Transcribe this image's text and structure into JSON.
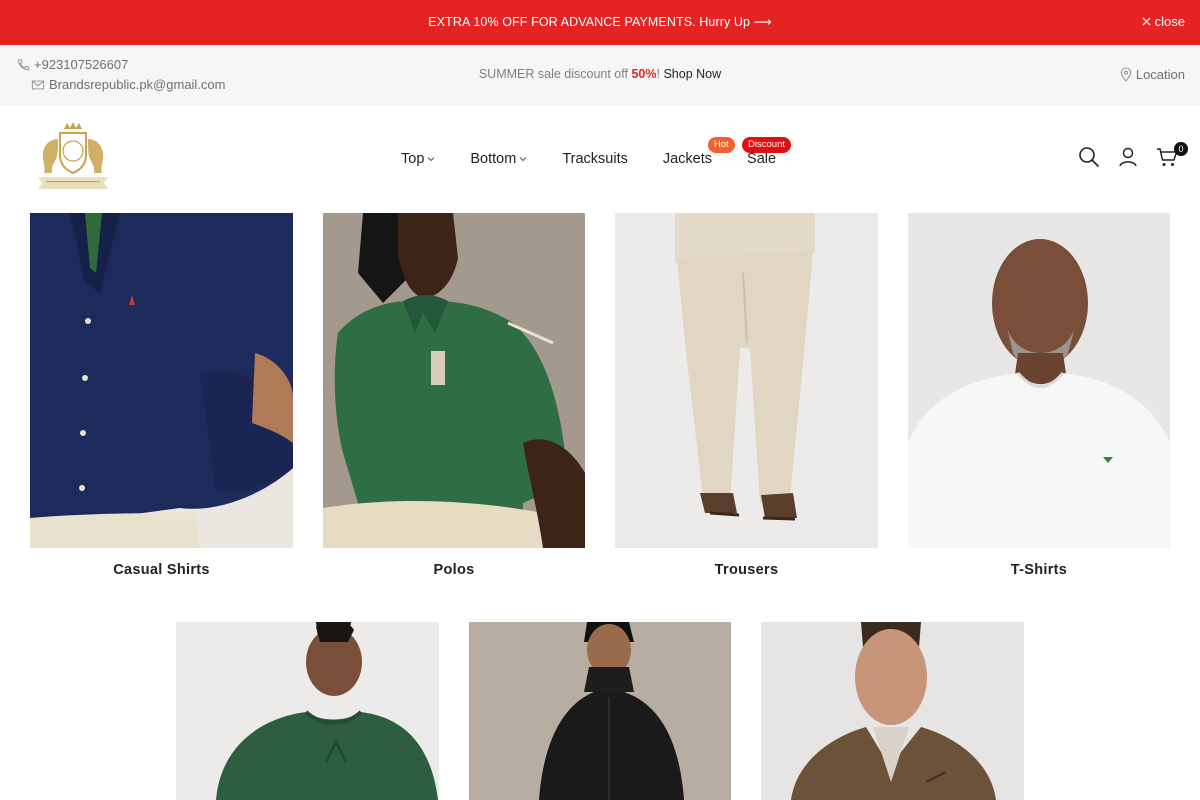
{
  "promo": {
    "text": "EXTRA 10% OFF FOR ADVANCE PAYMENTS. Hurry Up ⟶",
    "close_label": "close"
  },
  "infobar": {
    "phone": "+923107526607",
    "email": "Brandsrepublic.pk@gmail.com",
    "summer_prefix": "SUMMER sale discount off ",
    "summer_pct": "50%",
    "summer_bang": "!",
    "shop_now": "Shop Now",
    "location": "Location"
  },
  "nav": {
    "items": [
      {
        "label": "Top",
        "has_dropdown": true
      },
      {
        "label": "Bottom",
        "has_dropdown": true
      },
      {
        "label": "Tracksuits",
        "has_dropdown": false
      },
      {
        "label": "Jackets",
        "has_dropdown": false,
        "badge": "Hot"
      },
      {
        "label": "Sale",
        "has_dropdown": false,
        "badge": "Discount"
      }
    ]
  },
  "header": {
    "cart_count": "0",
    "icons": [
      "search-icon",
      "user-icon",
      "cart-icon"
    ]
  },
  "categories": [
    {
      "label": "Casual Shirts"
    },
    {
      "label": "Polos"
    },
    {
      "label": "Trousers"
    },
    {
      "label": "T-Shirts"
    },
    {
      "label": ""
    },
    {
      "label": ""
    },
    {
      "label": ""
    }
  ],
  "colors": {
    "promo_bg": "#e62323",
    "infobar_bg": "#f6f6f8",
    "hot_badge": "#f0612e",
    "discount_badge": "#e10f0f",
    "logo_gold": "#c9a24a"
  }
}
